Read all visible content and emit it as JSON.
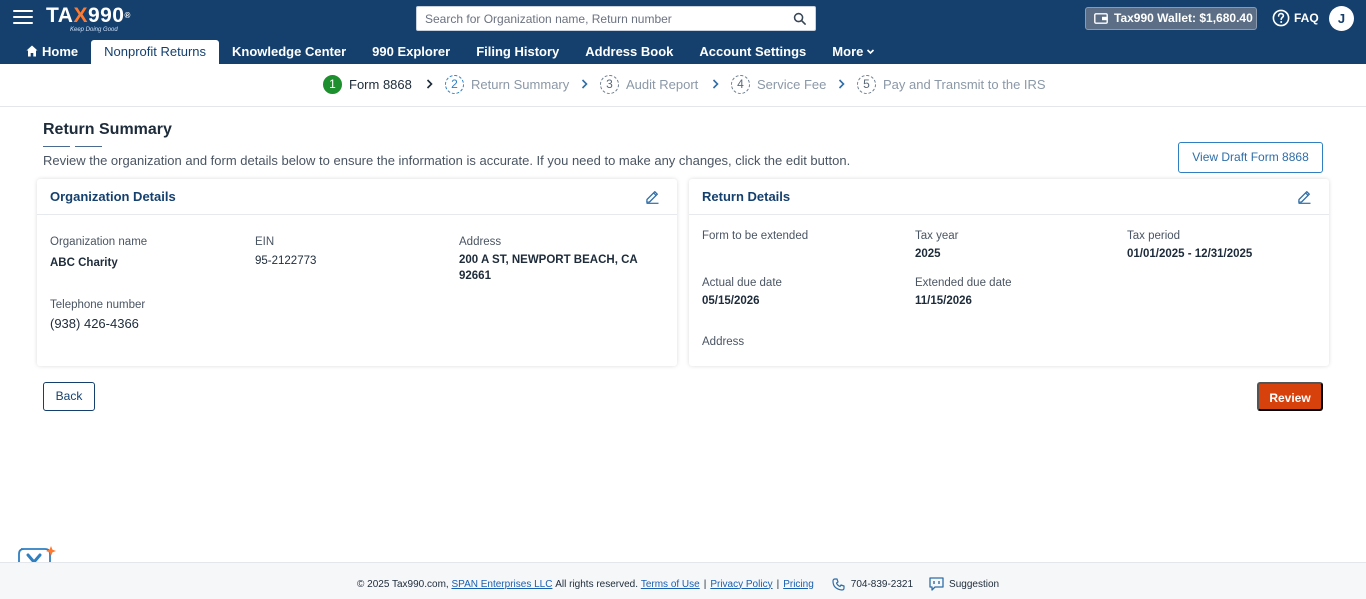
{
  "header": {
    "logo_prefix": "TA",
    "logo_x": "X",
    "logo_suffix": "990",
    "logo_registered": "®",
    "logo_tagline": "Keep Doing Good",
    "search_placeholder": "Search for Organization name, Return number",
    "wallet_label": "Tax990 Wallet: $1,680.40",
    "faq_label": "FAQ",
    "avatar_initial": "J"
  },
  "nav": {
    "items": [
      {
        "label": "Home",
        "icon": "home-icon"
      },
      {
        "label": "Nonprofit Returns",
        "active": true
      },
      {
        "label": "Knowledge Center"
      },
      {
        "label": "990 Explorer"
      },
      {
        "label": "Filing History"
      },
      {
        "label": "Address Book"
      },
      {
        "label": "Account Settings"
      },
      {
        "label": "More",
        "icon": "chevron-down-icon"
      }
    ]
  },
  "stepper": {
    "steps": [
      {
        "num": "1",
        "label": "Form 8868",
        "state": "active"
      },
      {
        "num": "2",
        "label": "Return Summary",
        "state": "current"
      },
      {
        "num": "3",
        "label": "Audit Report",
        "state": "pending"
      },
      {
        "num": "4",
        "label": "Service Fee",
        "state": "pending"
      },
      {
        "num": "5",
        "label": "Pay and Transmit to the IRS",
        "state": "pending"
      }
    ]
  },
  "page": {
    "title": "Return Summary",
    "description": "Review the organization and form details below to ensure the information is accurate. If you need to make any changes, click the edit button.",
    "view_draft_label": "View Draft Form 8868"
  },
  "org_card": {
    "title": "Organization Details",
    "org_name_label": "Organization name",
    "org_name": "ABC Charity",
    "ein_label": "EIN",
    "ein": "95-2122773",
    "address_label": "Address",
    "address_line1": "200 A ST, NEWPORT BEACH, CA",
    "address_line2": "92661",
    "phone_label": "Telephone number",
    "phone": "(938) 426-4366"
  },
  "return_card": {
    "title": "Return Details",
    "form_label": "Form to be extended",
    "tax_year_label": "Tax year",
    "tax_year": "2025",
    "tax_period_label": "Tax period",
    "tax_period": "01/01/2025 - 12/31/2025",
    "due_label": "Actual due date",
    "due_date": "05/15/2026",
    "ext_label": "Extended due date",
    "ext_date": "11/15/2026",
    "address_label": "Address"
  },
  "actions": {
    "back_label": "Back",
    "review_label": "Review"
  },
  "footer": {
    "copyright": "© 2025 Tax990.com,",
    "company_link": "SPAN Enterprises LLC",
    "rights": "All rights reserved.",
    "terms": "Terms of Use",
    "privacy": "Privacy Policy",
    "pricing": "Pricing",
    "phone": "704-839-2321",
    "suggestion": "Suggestion"
  },
  "colors": {
    "header_bg": "#15406e",
    "accent_orange": "#d6410c",
    "step_active": "#1e8f2e",
    "link_blue": "#1a5fb0"
  }
}
